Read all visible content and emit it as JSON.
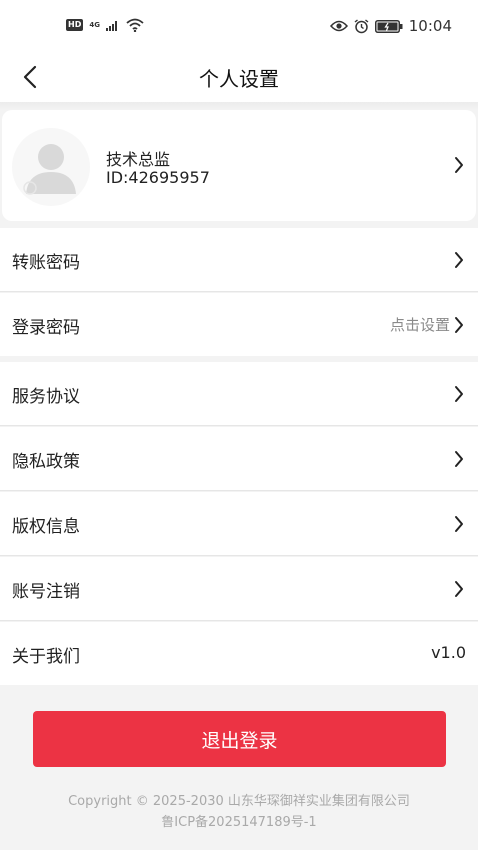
{
  "status_bar": {
    "hd": "HD",
    "network": "4G",
    "time": "10:04",
    "icons": [
      "signal-icon",
      "wifi-icon",
      "eye-icon",
      "alarm-icon",
      "battery-icon"
    ]
  },
  "nav": {
    "title": "个人设置",
    "back_icon": "chevron-left-icon"
  },
  "profile": {
    "name": "技术总监",
    "id": "ID:42695957"
  },
  "settings": [
    {
      "label": "转账密码",
      "hint": "",
      "value": ""
    },
    {
      "label": "登录密码",
      "hint": "点击设置",
      "value": ""
    },
    {
      "label": "服务协议",
      "hint": "",
      "value": ""
    },
    {
      "label": "隐私政策",
      "hint": "",
      "value": ""
    },
    {
      "label": "版权信息",
      "hint": "",
      "value": ""
    },
    {
      "label": "账号注销",
      "hint": "",
      "value": ""
    },
    {
      "label": "关于我们",
      "hint": "",
      "value": "v1.0"
    }
  ],
  "logout_label": "退出登录",
  "footer": {
    "copyright": "Copyright © 2025-2030 山东华琛御祥实业集团有限公司",
    "icp": "鲁ICP备2025147189号-1"
  },
  "colors": {
    "accent": "#ec3344",
    "background": "#f3f3f3"
  }
}
